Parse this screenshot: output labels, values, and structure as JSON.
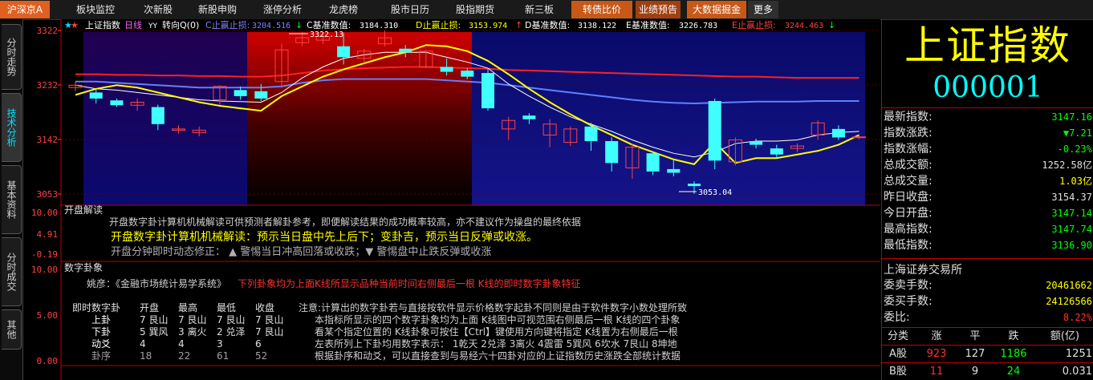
{
  "topbar": {
    "items": [
      "沪深京A",
      "板块监控",
      "次新股",
      "新股申购",
      "涨停分析",
      "龙虎榜",
      "股市日历",
      "股指期货",
      "新三板",
      "转债比价",
      "业绩预告",
      "大数据掘金",
      "更多"
    ]
  },
  "lefttabs": [
    "分时走势",
    "技术分析",
    "基本资料",
    "分时成交",
    "其他"
  ],
  "legend": {
    "name": "上证指数",
    "period": "日线",
    "yy": "YY",
    "turn": "转向Q(0)",
    "c_label": "C止赢止损:",
    "c_value": "3204.516",
    "c_arrow": "↓",
    "cb_label": "C基准数值:",
    "cb_value": "3184.310",
    "d_label": "D止赢止损:",
    "d_value": "3153.974",
    "d_arrow": "↑",
    "db_label": "D基准数值:",
    "db_value": "3138.122",
    "eb_label": "E基准数值:",
    "eb_value": "3226.783",
    "e_label": "E止赢止损:",
    "e_value": "3244.463",
    "e_arrow": "↓"
  },
  "axis": {
    "main": [
      "3322",
      "3232",
      "3142",
      "3053"
    ],
    "sub1": [
      "10.00",
      "4.91",
      "-0.19"
    ],
    "sub2": [
      "10.00",
      "5.00",
      "0.00"
    ]
  },
  "annot": {
    "high": "3322.13",
    "low": "3053.04"
  },
  "panel1": {
    "title": "开盘解读",
    "desc": "开盘数字卦计算机机械解读可供预测者解卦参考，即便解读结果的成功概率较高，亦不建议作为操盘的最终依据",
    "main": "开盘数字卦计算机机械解读：预示当日盘中先上后下；变卦吉，预示当日反弹或收涨。",
    "fix": "开盘分钟即时动态修正：  ▲ 警惕当日冲高回落或收跌；▼ 警惕盘中止跌反弹或收涨"
  },
  "panel2": {
    "title": "数字卦象",
    "author": "姚彦：《金融市场统计易学系统》",
    "subtitle": "下列卦象均为上面K线所显示品种当前时间右侧最后一根 K线的即时数字卦象特征",
    "headers": [
      "即时数字卦",
      "开盘",
      "最高",
      "最低",
      "收盘"
    ],
    "rows": [
      [
        "上卦",
        "7 艮山",
        "7 艮山",
        "7 艮山",
        "7 艮山"
      ],
      [
        "下卦",
        "5 巽风",
        "3 离火",
        "2 兑泽",
        "7 艮山"
      ],
      [
        "动爻",
        "4",
        "4",
        "3",
        "6"
      ],
      [
        "卦序",
        "18",
        "22",
        "61",
        "52"
      ]
    ],
    "notes": [
      "注意:计算出的数字卦若与直接按软件显示价格数字起卦不同则是由于软件数字小数处理所致",
      "本指标所显示的四个数字卦象均为上面 K线图中可视范围右侧最后一根 K线的四个卦象",
      "看某个指定位置的 K线卦象可按住【Ctrl】键使用方向键将指定 K线置为右侧最后一根",
      "左表所列上下卦均用数字表示： 1乾天 2兑泽 3离火 4震雷 5巽风 6坎水 7艮山 8坤地",
      "根据卦序和动爻，可以直接查到与易经六十四卦对应的上证指数历史涨跌全部统计数据"
    ]
  },
  "right": {
    "title": "上证指数",
    "code": "000001",
    "quotes": [
      {
        "label": "最新指数:",
        "value": "3147.16",
        "color": "#00ff00"
      },
      {
        "label": "指数涨跌:",
        "value": "▼7.21",
        "color": "#00ff00"
      },
      {
        "label": "指数涨幅:",
        "value": "-0.23%",
        "color": "#00ff00"
      },
      {
        "label": "总成交额:",
        "value": "1252.58亿",
        "color": "#e0e0e0"
      },
      {
        "label": "总成交量:",
        "value": "1.03亿",
        "color": "#ffff00"
      },
      {
        "label": "昨日收盘:",
        "value": "3154.37",
        "color": "#e0e0e0"
      },
      {
        "label": "今日开盘:",
        "value": "3147.14",
        "color": "#00ff00"
      },
      {
        "label": "最高指数:",
        "value": "3147.74",
        "color": "#00ff00"
      },
      {
        "label": "最低指数:",
        "value": "3136.90",
        "color": "#00ff00"
      }
    ],
    "exchange": "上海证券交易所",
    "orders": [
      {
        "label": "委卖手数:",
        "value": "20461662",
        "color": "#ffff00"
      },
      {
        "label": "委买手数:",
        "value": "24126566",
        "color": "#ffff00"
      },
      {
        "label": "委比:",
        "value": "8.22%",
        "color": "#ff3030"
      }
    ],
    "table": {
      "headers": [
        "分类",
        "涨",
        "平",
        "跌",
        "额(亿)"
      ],
      "rows": [
        [
          "A股",
          "923",
          "127",
          "1186",
          "1251"
        ],
        [
          "B股",
          "11",
          "9",
          "24",
          "0.031"
        ]
      ]
    }
  },
  "colors": {
    "up": "#ff4040",
    "down": "#40ffff",
    "ma_white": "#ffffff",
    "ma_yellow": "#ffff00",
    "ma_red": "#ff2020",
    "ma_blue": "#6080ff"
  },
  "chart_data": {
    "type": "candlestick",
    "ylim": [
      3053,
      3322
    ],
    "candles": [
      {
        "o": 3228,
        "h": 3238,
        "l": 3222,
        "c": 3232
      },
      {
        "o": 3220,
        "h": 3226,
        "l": 3202,
        "c": 3210
      },
      {
        "o": 3207,
        "h": 3210,
        "l": 3196,
        "c": 3199
      },
      {
        "o": 3199,
        "h": 3210,
        "l": 3190,
        "c": 3204
      },
      {
        "o": 3196,
        "h": 3200,
        "l": 3158,
        "c": 3168
      },
      {
        "o": 3158,
        "h": 3166,
        "l": 3152,
        "c": 3160
      },
      {
        "o": 3154,
        "h": 3164,
        "l": 3148,
        "c": 3158
      },
      {
        "o": 3208,
        "h": 3232,
        "l": 3200,
        "c": 3230
      },
      {
        "o": 3224,
        "h": 3230,
        "l": 3208,
        "c": 3214
      },
      {
        "o": 3222,
        "h": 3234,
        "l": 3206,
        "c": 3210
      },
      {
        "o": 3238,
        "h": 3300,
        "l": 3228,
        "c": 3290
      },
      {
        "o": 3302,
        "h": 3320,
        "l": 3296,
        "c": 3310
      },
      {
        "o": 3306,
        "h": 3316,
        "l": 3300,
        "c": 3312
      },
      {
        "o": 3296,
        "h": 3318,
        "l": 3266,
        "c": 3278
      },
      {
        "o": 3276,
        "h": 3292,
        "l": 3268,
        "c": 3288
      },
      {
        "o": 3300,
        "h": 3322,
        "l": 3296,
        "c": 3310
      },
      {
        "o": 3292,
        "h": 3298,
        "l": 3278,
        "c": 3286
      },
      {
        "o": 3262,
        "h": 3290,
        "l": 3260,
        "c": 3288
      },
      {
        "o": 3262,
        "h": 3276,
        "l": 3248,
        "c": 3254
      },
      {
        "o": 3256,
        "h": 3260,
        "l": 3242,
        "c": 3246
      },
      {
        "o": 3252,
        "h": 3258,
        "l": 3190,
        "c": 3194
      },
      {
        "o": 3160,
        "h": 3180,
        "l": 3142,
        "c": 3174
      },
      {
        "o": 3182,
        "h": 3186,
        "l": 3168,
        "c": 3176
      },
      {
        "o": 3150,
        "h": 3176,
        "l": 3130,
        "c": 3168
      },
      {
        "o": 3138,
        "h": 3164,
        "l": 3132,
        "c": 3160
      },
      {
        "o": 3164,
        "h": 3170,
        "l": 3124,
        "c": 3140
      },
      {
        "o": 3140,
        "h": 3146,
        "l": 3090,
        "c": 3104
      },
      {
        "o": 3096,
        "h": 3136,
        "l": 3078,
        "c": 3130
      },
      {
        "o": 3120,
        "h": 3122,
        "l": 3084,
        "c": 3090
      },
      {
        "o": 3094,
        "h": 3110,
        "l": 3082,
        "c": 3088
      },
      {
        "o": 3070,
        "h": 3074,
        "l": 3053,
        "c": 3066
      },
      {
        "o": 3206,
        "h": 3210,
        "l": 3094,
        "c": 3108
      },
      {
        "o": 3106,
        "h": 3146,
        "l": 3100,
        "c": 3142
      },
      {
        "o": 3140,
        "h": 3144,
        "l": 3128,
        "c": 3134
      },
      {
        "o": 3128,
        "h": 3134,
        "l": 3112,
        "c": 3118
      },
      {
        "o": 3128,
        "h": 3136,
        "l": 3122,
        "c": 3132
      },
      {
        "o": 3150,
        "h": 3174,
        "l": 3142,
        "c": 3170
      },
      {
        "o": 3160,
        "h": 3166,
        "l": 3142,
        "c": 3146
      },
      {
        "o": 3147,
        "h": 3150,
        "l": 3143,
        "c": 3147
      }
    ],
    "ma_yellow": [
      3216,
      3226,
      3232,
      3228,
      3220,
      3212,
      3204,
      3198,
      3194,
      3190,
      3214,
      3230,
      3246,
      3258,
      3268,
      3278,
      3286,
      3298,
      3296,
      3288,
      3272,
      3250,
      3226,
      3204,
      3184,
      3166,
      3150,
      3134,
      3122,
      3110,
      3102,
      3138,
      3104,
      3112,
      3112,
      3118,
      3124,
      3134,
      3150
    ],
    "ma_white": [
      3232,
      3226,
      3224,
      3220,
      3216,
      3212,
      3208,
      3206,
      3205,
      3204,
      3220,
      3244,
      3262,
      3276,
      3282,
      3286,
      3286,
      3286,
      3278,
      3270,
      3260,
      3234,
      3214,
      3196,
      3180,
      3168,
      3156,
      3142,
      3130,
      3120,
      3114,
      3122,
      3136,
      3140,
      3140,
      3142,
      3150,
      3154,
      3156
    ],
    "ma_red": [
      3250,
      3250,
      3249,
      3249,
      3248,
      3248,
      3247,
      3247,
      3246,
      3246,
      3248,
      3252,
      3256,
      3258,
      3260,
      3261,
      3262,
      3262,
      3261,
      3260,
      3259,
      3257,
      3256,
      3255,
      3254,
      3253,
      3252,
      3251,
      3250,
      3249,
      3248,
      3247,
      3246,
      3246,
      3245,
      3244,
      3244,
      3244,
      3244
    ],
    "ma_blue": [
      3238,
      3238,
      3236,
      3234,
      3232,
      3230,
      3228,
      3228,
      3228,
      3228,
      3230,
      3236,
      3240,
      3242,
      3242,
      3242,
      3242,
      3242,
      3240,
      3238,
      3236,
      3232,
      3228,
      3224,
      3220,
      3216,
      3212,
      3208,
      3205,
      3203,
      3202,
      3203,
      3204,
      3205,
      3205,
      3205,
      3206,
      3206,
      3206
    ]
  }
}
